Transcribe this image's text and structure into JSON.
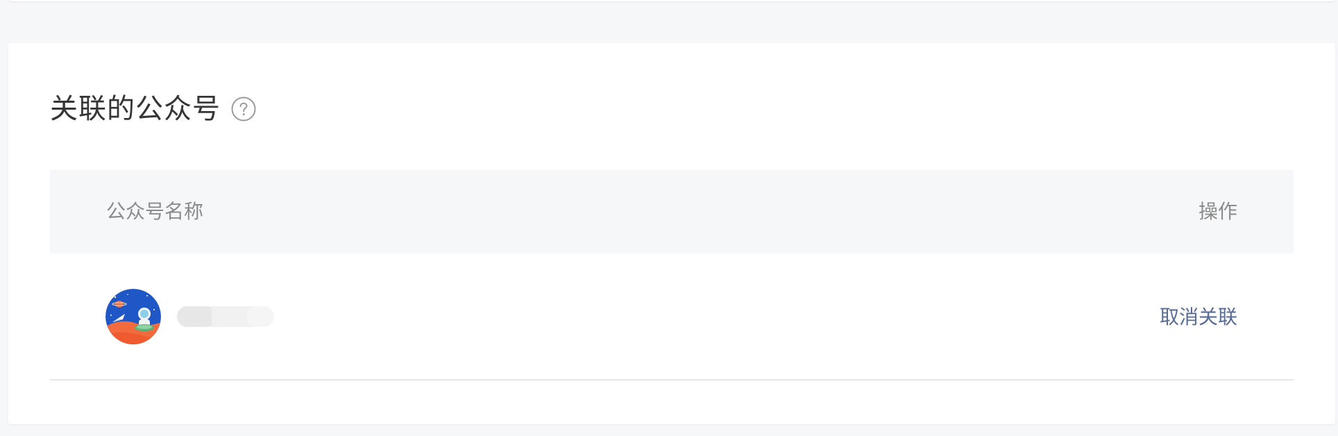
{
  "section": {
    "title": "关联的公众号"
  },
  "table": {
    "columns": {
      "name": "公众号名称",
      "operation": "操作"
    },
    "rows": [
      {
        "name": "",
        "action": "取消关联"
      }
    ]
  },
  "icons": {
    "help": "question-circle-icon",
    "avatar": "space-illustration-avatar"
  },
  "colors": {
    "page_bg": "#f6f7f9",
    "card_bg": "#ffffff",
    "link": "#576b95",
    "header_text": "#8b8b8b",
    "title_text": "#353535"
  }
}
